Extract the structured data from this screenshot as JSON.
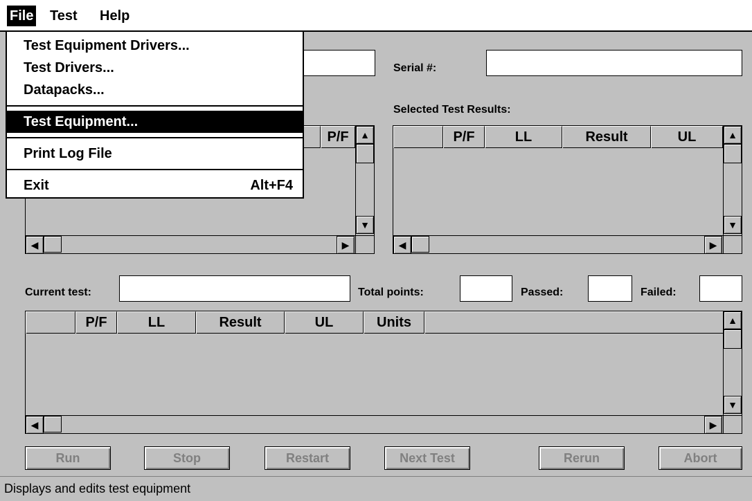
{
  "menubar": {
    "file": "File",
    "test": "Test",
    "help": "Help"
  },
  "labels": {
    "serial": "Serial #:",
    "selected_results": "Selected Test Results:",
    "current_test": "Current test:",
    "total_points": "Total points:",
    "passed": "Passed:",
    "failed": "Failed:"
  },
  "fields": {
    "serial": "",
    "current_test": "",
    "total_points": "",
    "passed": "",
    "failed": ""
  },
  "left_grid": {
    "columns": [
      "P/F"
    ]
  },
  "selected_grid": {
    "columns": [
      "",
      "P/F",
      "LL",
      "Result",
      "UL"
    ]
  },
  "results_grid": {
    "columns": [
      "",
      "P/F",
      "LL",
      "Result",
      "UL",
      "Units",
      ""
    ]
  },
  "buttons": {
    "run": "Run",
    "stop": "Stop",
    "restart": "Restart",
    "next_test": "Next Test",
    "rerun": "Rerun",
    "abort": "Abort"
  },
  "file_menu": {
    "items": [
      {
        "label": "Test Equipment Drivers..."
      },
      {
        "label": "Test Drivers..."
      },
      {
        "label": "Datapacks..."
      },
      {
        "label": "Test Equipment..."
      },
      {
        "label": "Print Log File"
      },
      {
        "label": "Exit",
        "accelerator": "Alt+F4"
      }
    ],
    "selected_index": 3
  },
  "status_bar": "Displays and edits test equipment",
  "icons": {
    "scroll_up": "arrow-up-icon",
    "scroll_down": "arrow-down-icon",
    "scroll_left": "arrow-left-icon",
    "scroll_right": "arrow-right-icon"
  },
  "colors": {
    "face": "#c0c0c0",
    "highlight": "#000000",
    "disabled_text": "#808080"
  }
}
